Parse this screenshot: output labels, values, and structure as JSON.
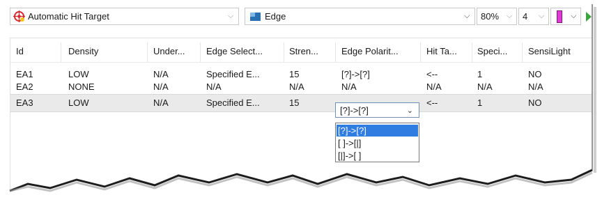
{
  "toolbar": {
    "target_combo": {
      "label": "Automatic Hit Target",
      "icon": "crosshair-target-icon"
    },
    "edge_combo": {
      "label": "Edge",
      "icon": "edge-tool-icon"
    },
    "zoom": "80%",
    "count": "4",
    "color": "#e23ad6"
  },
  "grid": {
    "columns": [
      "Id",
      "Density",
      "Under...",
      "Edge Select...",
      "Stren...",
      "Edge Polarit...",
      "Hit Ta...",
      "Speci...",
      "SensiLight"
    ],
    "rows": [
      [
        "EA1",
        "LOW",
        "N/A",
        "Specified E...",
        "15",
        "[?]->[?]",
        "<--",
        "1",
        "NO"
      ],
      [
        "EA2",
        "NONE",
        "N/A",
        "N/A",
        "N/A",
        "N/A",
        "N/A",
        "N/A",
        "N/A"
      ],
      [
        "EA3",
        "LOW",
        "N/A",
        "Specified E...",
        "15",
        "[?]->[?]",
        "<--",
        "1",
        "NO"
      ]
    ],
    "selected_row": 2
  },
  "polarity_dropdown": {
    "value": "[?]->[?]",
    "options": [
      "[?]->[?]",
      "[ ]->[|]",
      "[|]->[ ]"
    ],
    "highlighted": 0
  }
}
